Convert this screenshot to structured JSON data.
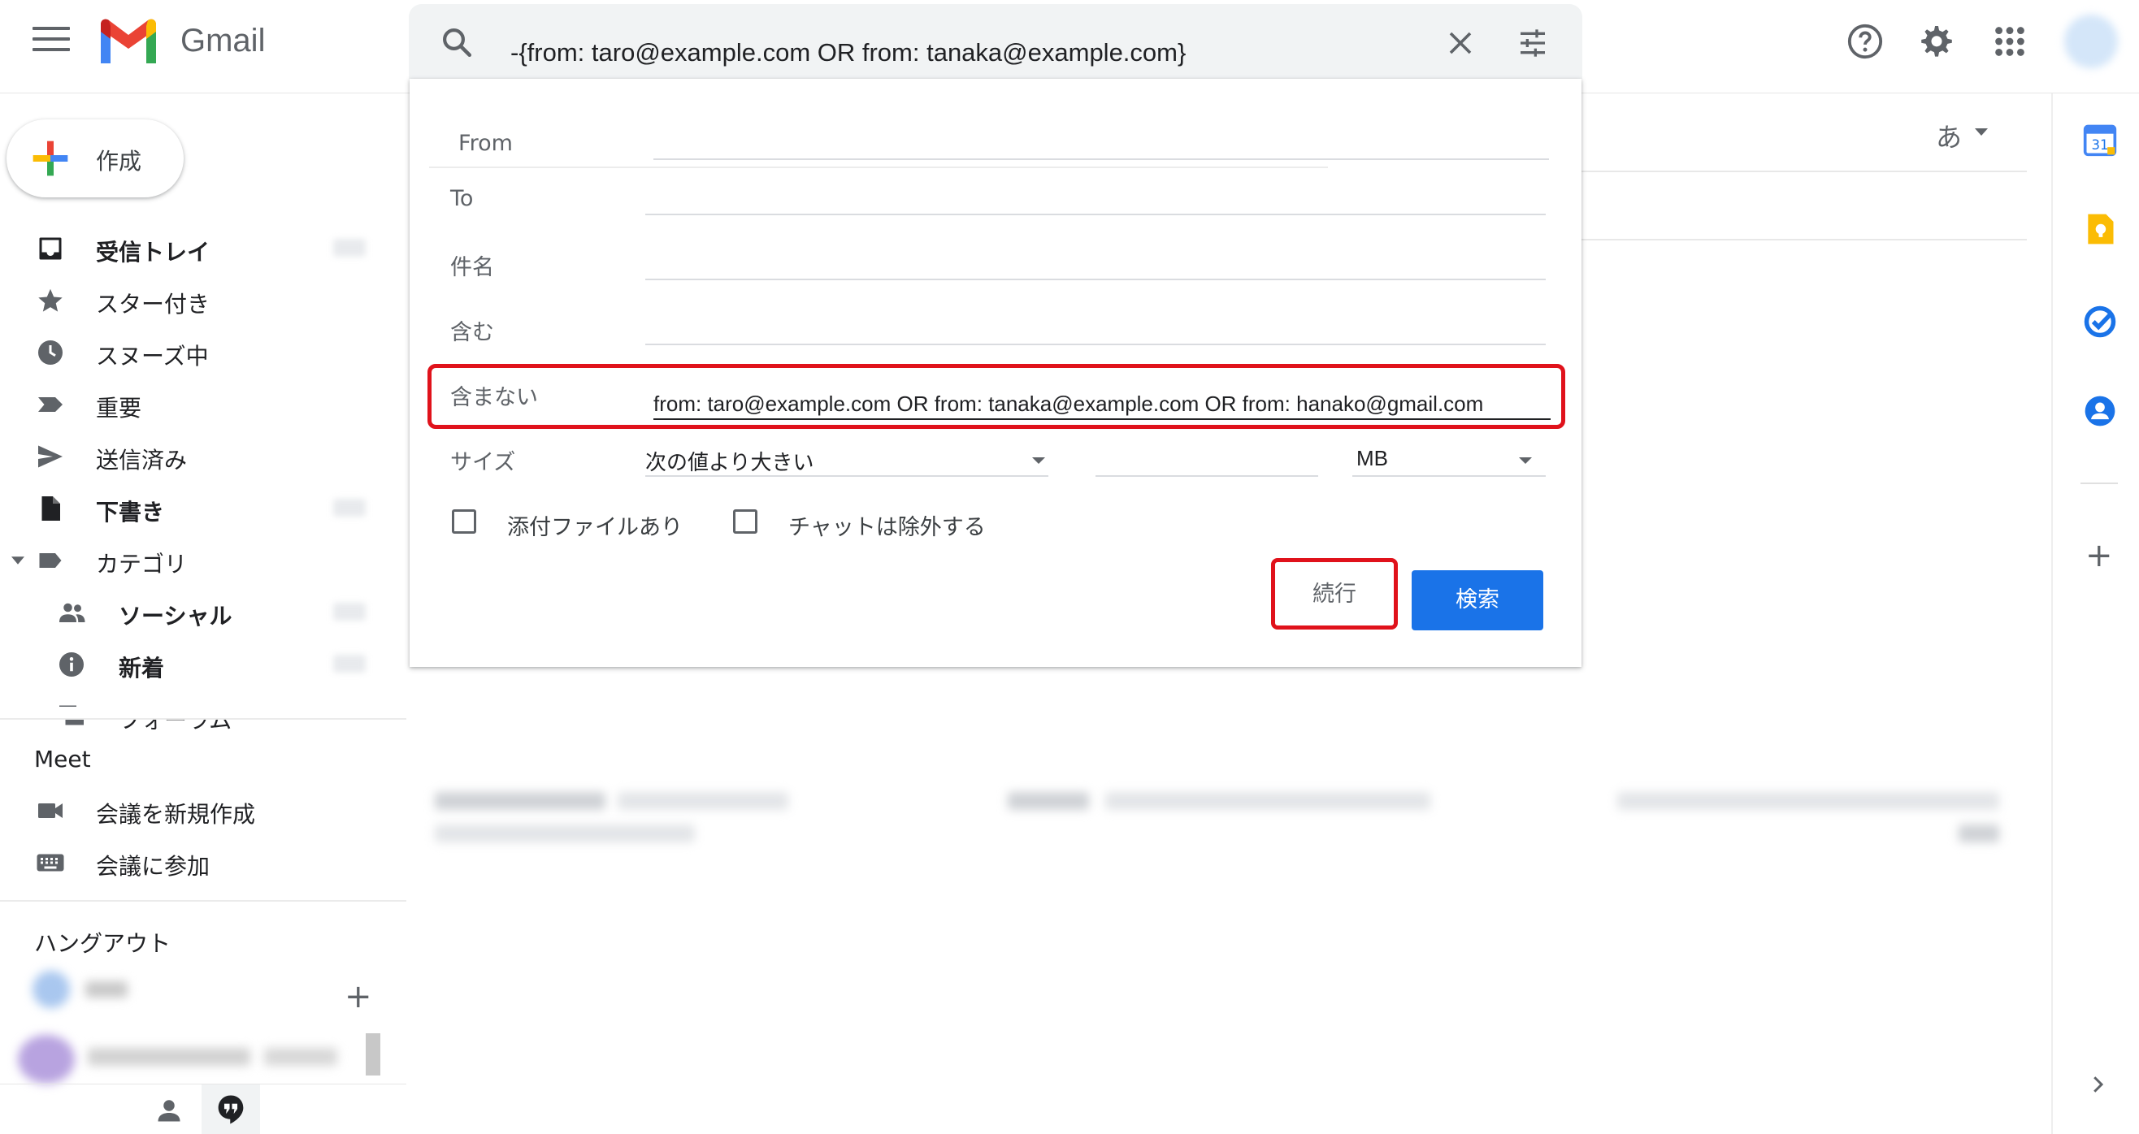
{
  "app": {
    "name": "Gmail"
  },
  "search": {
    "query": "-{from: taro@example.com OR from: tanaka@example.com}"
  },
  "compose": {
    "label": "作成"
  },
  "nav": {
    "inbox": "受信トレイ",
    "starred": "スター付き",
    "snoozed": "スヌーズ中",
    "important": "重要",
    "sent": "送信済み",
    "drafts": "下書き",
    "categories": "カテゴリ",
    "social": "ソーシャル",
    "updates": "新着",
    "forums": "フォーラム"
  },
  "meet": {
    "title": "Meet",
    "new_meeting": "会議を新規作成",
    "join_meeting": "会議に参加"
  },
  "hangouts": {
    "title": "ハングアウト",
    "add": "+"
  },
  "input_tool": {
    "label": "あ"
  },
  "advanced_search": {
    "from_label": "From",
    "to_label": "To",
    "subject_label": "件名",
    "has_words_label": "含む",
    "not_words_label": "含まない",
    "not_words_value": "from: taro@example.com OR from: tanaka@example.com OR from: hanako@gmail.com",
    "size_label": "サイズ",
    "size_operator": "次の値より大きい",
    "size_unit": "MB",
    "has_attachment_label": "添付ファイルあり",
    "exclude_chats_label": "チャットは除外する",
    "continue_label": "続行",
    "search_label": "検索"
  },
  "side_panel": {
    "add": "+"
  },
  "colors": {
    "primary": "#1a73e8",
    "highlight": "#e0121b"
  }
}
